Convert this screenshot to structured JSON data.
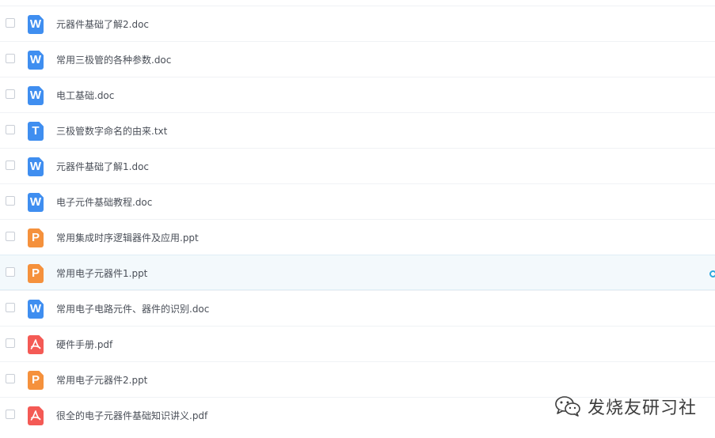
{
  "files": [
    {
      "name": "元器件基础了解2.doc",
      "type": "word",
      "icon": "word-file-icon",
      "glyph": "W"
    },
    {
      "name": "常用三极管的各种参数.doc",
      "type": "word",
      "icon": "word-file-icon",
      "glyph": "W"
    },
    {
      "name": "电工基础.doc",
      "type": "word",
      "icon": "word-file-icon",
      "glyph": "W"
    },
    {
      "name": "三极管数字命名的由来.txt",
      "type": "txt",
      "icon": "text-file-icon",
      "glyph": "T"
    },
    {
      "name": "元器件基础了解1.doc",
      "type": "word",
      "icon": "word-file-icon",
      "glyph": "W"
    },
    {
      "name": "电子元件基础教程.doc",
      "type": "word",
      "icon": "word-file-icon",
      "glyph": "W"
    },
    {
      "name": "常用集成时序逻辑器件及应用.ppt",
      "type": "ppt",
      "icon": "ppt-file-icon",
      "glyph": "P"
    },
    {
      "name": "常用电子元器件1.ppt",
      "type": "ppt",
      "icon": "ppt-file-icon",
      "glyph": "P",
      "hovered": true
    },
    {
      "name": "常用电子电路元件、器件的识别.doc",
      "type": "word",
      "icon": "word-file-icon",
      "glyph": "W"
    },
    {
      "name": "硬件手册.pdf",
      "type": "pdf",
      "icon": "pdf-file-icon",
      "glyph": ""
    },
    {
      "name": "常用电子元器件2.ppt",
      "type": "ppt",
      "icon": "ppt-file-icon",
      "glyph": "P"
    },
    {
      "name": "很全的电子元器件基础知识讲义.pdf",
      "type": "pdf",
      "icon": "pdf-file-icon",
      "glyph": ""
    }
  ],
  "watermark": {
    "text": "发烧友研习社",
    "icon": "wechat-icon"
  },
  "colors": {
    "word": "#3f8ef0",
    "ppt": "#f5913c",
    "pdf": "#f45a55",
    "hover_row": "#f3f9fc",
    "accent": "#2fa8dc"
  }
}
